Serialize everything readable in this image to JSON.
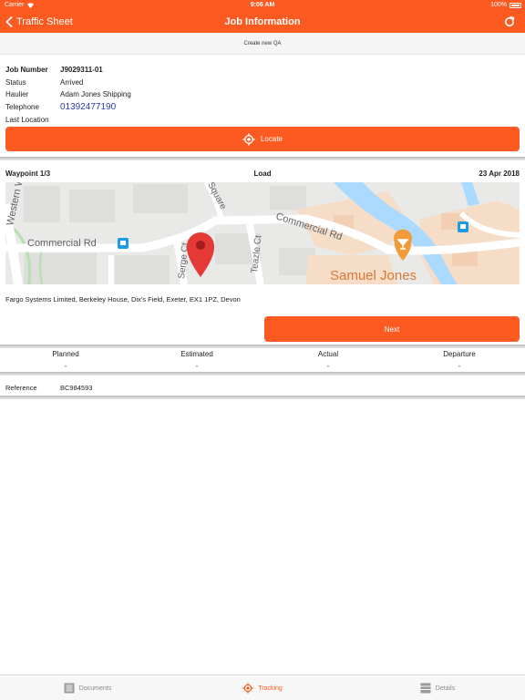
{
  "status_bar": {
    "carrier": "Carrier",
    "time": "9:06 AM",
    "battery": "100%"
  },
  "nav": {
    "back_label": "Traffic Sheet",
    "title": "Job Information"
  },
  "qa": {
    "label": "Create new QA"
  },
  "job": {
    "rows": [
      {
        "key": "Job Number",
        "value": "J9029311-01"
      },
      {
        "key": "Status",
        "value": "Arrived"
      },
      {
        "key": "Haulier",
        "value": "Adam Jones Shipping"
      },
      {
        "key": "Telephone",
        "value": "01392477190"
      },
      {
        "key": "Last Location",
        "value": ""
      }
    ],
    "locate_label": "Locate"
  },
  "waypoint": {
    "label": "Waypoint 1/3",
    "type": "Load",
    "date": "23 Apr 2018",
    "map_labels": {
      "western_way": "Western Way",
      "commercial_rd_left": "Commercial Rd",
      "commercial_rd_right": "Commercial Rd",
      "square": "Square",
      "serge_ct": "Serge Ct",
      "teazle_ct": "Teazle Ct",
      "samuel_jones": "Samuel Jones"
    },
    "address": "Fargo Systems Limited, Berkeley House, Dix's Field, Exeter, EX1 1PZ, Devon",
    "next_label": "Next"
  },
  "times": [
    {
      "label": "Planned",
      "value": "-"
    },
    {
      "label": "Estimated",
      "value": "-"
    },
    {
      "label": "Actual",
      "value": "-"
    },
    {
      "label": "Departure",
      "value": "-"
    }
  ],
  "reference": {
    "key": "Reference",
    "value": "BC984593"
  },
  "tabs": [
    {
      "label": "Documents"
    },
    {
      "label": "Tracking"
    },
    {
      "label": "Details"
    }
  ],
  "colors": {
    "accent": "#fd5a21",
    "phone": "#2b3bb0",
    "river": "#aadaff",
    "pin": "#e53935"
  },
  "active_tab": "Tracking"
}
